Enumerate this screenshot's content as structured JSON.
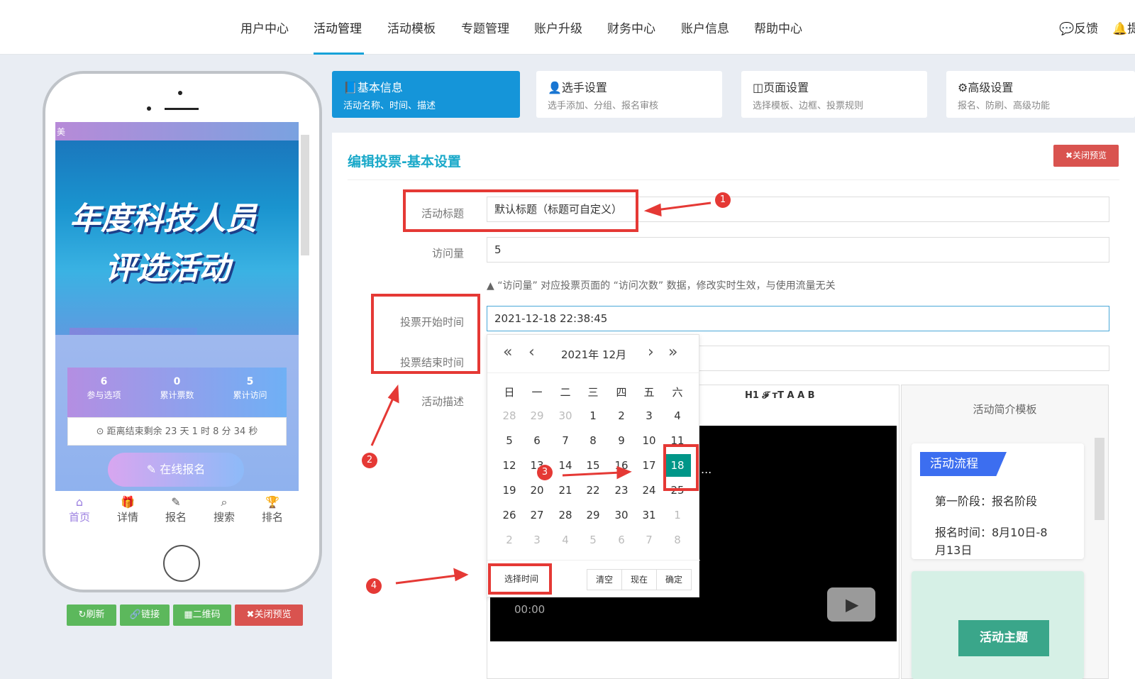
{
  "nav": {
    "items": [
      "用户中心",
      "活动管理",
      "活动模板",
      "专题管理",
      "账户升级",
      "财务中心",
      "账户信息",
      "帮助中心"
    ],
    "feedback": "反馈",
    "cut_off": "提"
  },
  "phone": {
    "topbar_text": "美",
    "banner_line1": "年度科技人员",
    "banner_line2": "评选活动",
    "stats": [
      {
        "value": "6",
        "label": "参与选项"
      },
      {
        "value": "0",
        "label": "累计票数"
      },
      {
        "value": "5",
        "label": "累计访问"
      }
    ],
    "countdown": "距离结束剩余 23 天 1 时 8 分 34 秒",
    "signup": "在线报名",
    "tabs": [
      "首页",
      "详情",
      "报名",
      "搜索",
      "排名"
    ],
    "buttons": [
      "刷新",
      "链接",
      "二维码",
      "关闭预览"
    ]
  },
  "steps": [
    {
      "title": "基本信息",
      "sub": "活动名称、时间、描述"
    },
    {
      "title": "选手设置",
      "sub": "选手添加、分组、报名审核"
    },
    {
      "title": "页面设置",
      "sub": "选择模板、边框、投票规则"
    },
    {
      "title": "高级设置",
      "sub": "报名、防刷、高级功能"
    }
  ],
  "form": {
    "title": "编辑投票-基本设置",
    "close_preview": "关闭预览",
    "label_title": "活动标题",
    "value_title": "默认标题（标题可自定义）",
    "label_visits": "访问量",
    "value_visits": "5",
    "hint": "▲ “访问量” 对应投票页面的 “访问次数” 数据，修改实时生效，与使用流量无关",
    "label_start": "投票开始时间",
    "value_start": "2021-12-18 22:38:45",
    "label_end": "投票结束时间",
    "label_desc": "活动描述"
  },
  "calendar": {
    "year_month": "2021年  12月",
    "weekdays": [
      "日",
      "一",
      "二",
      "三",
      "四",
      "五",
      "六"
    ],
    "weeks": [
      [
        "28",
        "29",
        "30",
        "1",
        "2",
        "3",
        "4"
      ],
      [
        "5",
        "6",
        "7",
        "8",
        "9",
        "10",
        "11"
      ],
      [
        "12",
        "13",
        "14",
        "15",
        "16",
        "17",
        "18"
      ],
      [
        "19",
        "20",
        "21",
        "22",
        "23",
        "24",
        "25"
      ],
      [
        "26",
        "27",
        "28",
        "29",
        "30",
        "31",
        "1"
      ],
      [
        "2",
        "3",
        "4",
        "5",
        "6",
        "7",
        "8"
      ]
    ],
    "selected": "18",
    "select_time": "选择时间",
    "clear": "清空",
    "now": "现在",
    "confirm": "确定"
  },
  "editor": {
    "toolbar": "H1  𝓕  тT  A  A  B",
    "video_time": "00:00",
    "ellipsis": "..."
  },
  "template": {
    "head": "活动简介模板",
    "card_title": "活动流程",
    "line1": "第一阶段：报名阶段",
    "line2": "报名时间：8月10日-8",
    "line3": "月13日",
    "card2_title": "活动主题"
  },
  "annotations": [
    "1",
    "2",
    "3",
    "4"
  ],
  "colors": {
    "accent": "#1595d9",
    "selected_day": "#009688",
    "marker": "#e53935",
    "danger": "#d9534f",
    "success": "#5cb85c"
  }
}
